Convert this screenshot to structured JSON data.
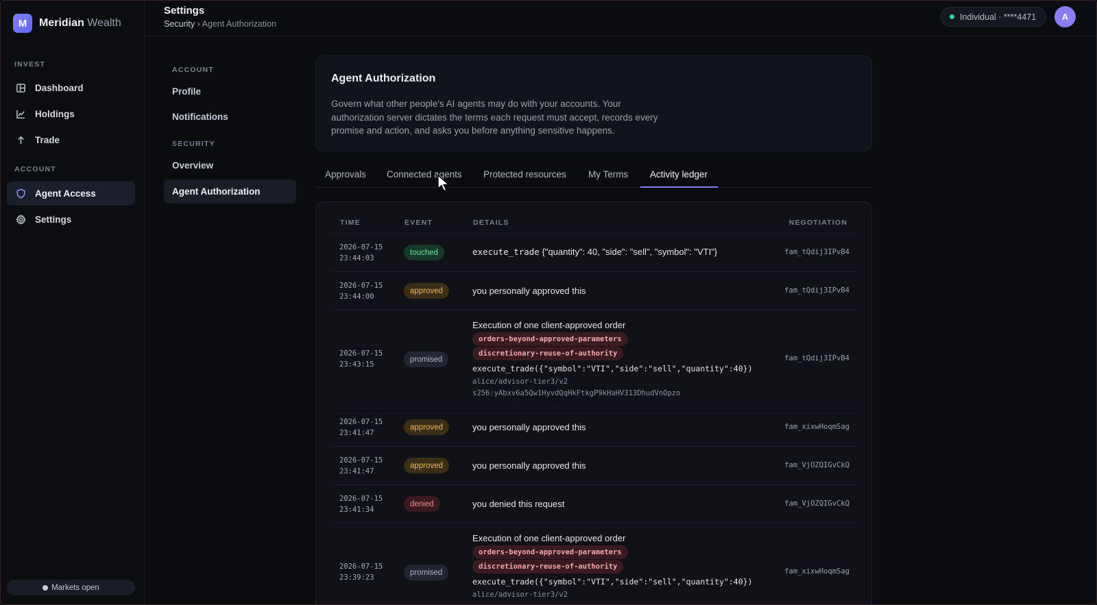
{
  "brand": {
    "logo_letter": "M",
    "name": "Meridian",
    "sub": "Wealth"
  },
  "sidebar": {
    "sections": [
      {
        "label": "INVEST",
        "items": [
          {
            "label": "Dashboard",
            "icon": "dashboard-icon"
          },
          {
            "label": "Holdings",
            "icon": "chart-line-icon"
          },
          {
            "label": "Trade",
            "icon": "arrow-up-icon"
          }
        ]
      },
      {
        "label": "ACCOUNT",
        "items": [
          {
            "label": "Agent Access",
            "icon": "shield-icon",
            "active": true
          },
          {
            "label": "Settings",
            "icon": "gear-icon"
          }
        ]
      }
    ],
    "markets_status": "Markets open"
  },
  "topbar": {
    "title": "Settings",
    "breadcrumb_first": "Security",
    "breadcrumb_sep": "›",
    "breadcrumb_current": "Agent Authorization",
    "account": "Individual · ****4471",
    "avatar_letter": "A"
  },
  "settings_nav": {
    "sections": [
      {
        "label": "ACCOUNT",
        "items": [
          "Profile",
          "Notifications"
        ]
      },
      {
        "label": "SECURITY",
        "items": [
          "Overview",
          "Agent Authorization"
        ]
      }
    ],
    "active": "Agent Authorization"
  },
  "intro": {
    "title": "Agent Authorization",
    "description": "Govern what other people's AI agents may do with your accounts. Your authorization server dictates the terms each request must accept, records every promise and action, and asks you before anything sensitive happens."
  },
  "tabs": [
    "Approvals",
    "Connected agents",
    "Protected resources",
    "My Terms",
    "Activity ledger"
  ],
  "active_tab": "Activity ledger",
  "ledger": {
    "headers": {
      "time": "TIME",
      "event": "EVENT",
      "details": "DETAILS",
      "negotiation": "NEGOTIATION"
    },
    "rows": [
      {
        "date": "2026-07-15",
        "time": "23:44:03",
        "event": "touched",
        "detail_mono": "execute_trade",
        "detail_text": " {\"quantity\": 40, \"side\": \"sell\", \"symbol\": \"VTI\"}",
        "negotiation": "fam_tQdij3IPvB4"
      },
      {
        "date": "2026-07-15",
        "time": "23:44:00",
        "event": "approved",
        "detail_text": "you personally approved this",
        "negotiation": "fam_tQdij3IPvB4"
      },
      {
        "date": "2026-07-15",
        "time": "23:43:15",
        "event": "promised",
        "detail_title": "Execution of one client-approved order",
        "tags": [
          "orders-beyond-approved-parameters",
          "discretionary-reuse-of-authority"
        ],
        "call": "execute_trade({\"symbol\":\"VTI\",\"side\":\"sell\",\"quantity\":40})",
        "agent": "alice/advisor-tier3/v2",
        "hash": "s256:yAbxv6a5Qw1HyvdQqHkFtkgP9kHaHV313DhudVnOpzo",
        "negotiation": "fam_tQdij3IPvB4"
      },
      {
        "date": "2026-07-15",
        "time": "23:41:47",
        "event": "approved",
        "detail_text": "you personally approved this",
        "negotiation": "fam_xixwHoqmSag"
      },
      {
        "date": "2026-07-15",
        "time": "23:41:47",
        "event": "approved",
        "detail_text": "you personally approved this",
        "negotiation": "fam_VjOZQIGvCkQ"
      },
      {
        "date": "2026-07-15",
        "time": "23:41:34",
        "event": "denied",
        "detail_text": "you denied this request",
        "negotiation": "fam_VjOZQIGvCkQ"
      },
      {
        "date": "2026-07-15",
        "time": "23:39:23",
        "event": "promised",
        "detail_title": "Execution of one client-approved order",
        "tags": [
          "orders-beyond-approved-parameters",
          "discretionary-reuse-of-authority"
        ],
        "call": "execute_trade({\"symbol\":\"VTI\",\"side\":\"sell\",\"quantity\":40})",
        "agent": "alice/advisor-tier3/v2",
        "negotiation": "fam_xixwHoqmSag"
      }
    ]
  }
}
